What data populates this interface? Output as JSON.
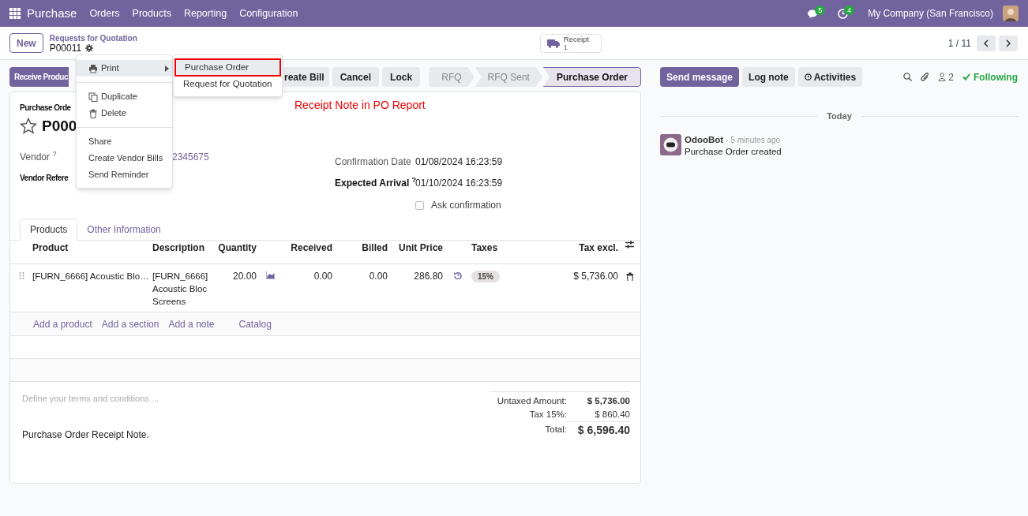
{
  "navbar": {
    "app_name": "Purchase",
    "menu": [
      "Orders",
      "Products",
      "Reporting",
      "Configuration"
    ],
    "messages_count": "5",
    "activities_count": "4",
    "company": "My Company (San Francisco)"
  },
  "control_panel": {
    "new_button": "New",
    "breadcrumb": "Requests for Quotation",
    "record": "P00011",
    "smart_button": {
      "label": "Receipt",
      "count": "1"
    },
    "pager": "1 / 11"
  },
  "actions": [
    {
      "label": "Receive Produc",
      "kind": "primary"
    },
    {
      "label": "reate Bill",
      "kind": "secondary"
    },
    {
      "label": "Cancel",
      "kind": "secondary"
    },
    {
      "label": "Lock",
      "kind": "secondary"
    }
  ],
  "statusbar": [
    {
      "label": "RFQ",
      "selected": false
    },
    {
      "label": "RFQ Sent",
      "selected": false
    },
    {
      "label": "Purchase Order",
      "selected": true
    }
  ],
  "gear_menu": {
    "groups": [
      [
        {
          "label": "Print",
          "kind": "submenu",
          "selected": true
        }
      ],
      [
        {
          "label": "Duplicate",
          "kind": "item",
          "selected": false
        },
        {
          "label": "Delete",
          "kind": "item",
          "selected": false
        }
      ],
      [
        {
          "label": "Share",
          "kind": "item",
          "selected": false
        },
        {
          "label": "Create Vendor Bills",
          "kind": "item",
          "selected": false
        },
        {
          "label": "Send Reminder",
          "kind": "item",
          "selected": false
        }
      ]
    ],
    "submenu": [
      {
        "label": "Purchase Order",
        "selected": true
      },
      {
        "label": "Request for Quotation",
        "selected": false
      }
    ]
  },
  "annotation": "Receipt Note in  PO Report",
  "form": {
    "title_label": "Purchase Orde",
    "name": "P000",
    "starred": false,
    "left_fields": [
      {
        "label": "Vendor $^{?}$",
        "value": "2345675",
        "bold_label": false
      },
      {
        "label": "Vendor Refere",
        "bold_label": true
      }
    ],
    "right_fields": [
      {
        "label": "Confirmation Date",
        "value": "01/08/2024 16:23:59",
        "bold_label": false
      },
      {
        "label": "Expected Arrival $^{?}$",
        "value": "01/10/2024 16:23:59",
        "bold_label": true
      }
    ],
    "ask_confirmation": {
      "label": "Ask confirmation",
      "checked": false
    },
    "tabs": [
      {
        "label": "Products",
        "selected": true
      },
      {
        "label": "Other Information",
        "selected": false
      }
    ],
    "table": {
      "columns": [
        "Product",
        "Description",
        "Quantity",
        "Received",
        "Billed",
        "Unit Price",
        "Taxes",
        "Tax excl."
      ],
      "rows": [
        {
          "product": "[FURN_6666] Acoustic Blo…",
          "description": [
            "[FURN_6666]",
            "Acoustic Bloc",
            "Screens"
          ],
          "quantity": "20.00",
          "received": "0.00",
          "billed": "0.00",
          "unit_price": "286.80",
          "taxes": "15%",
          "tax_excl": "$ 5,736.00"
        }
      ],
      "add_links": [
        "Add a product",
        "Add a section",
        "Add a note",
        "Catalog"
      ]
    },
    "terms_placeholder": "Define your terms and conditions ...",
    "note": "Purchase Order Receipt Note.",
    "totals": [
      {
        "label": "Untaxed Amount:",
        "value": "$ 5,736.00",
        "kind": "subtotal"
      },
      {
        "label": "Tax 15%:",
        "value": "$ 860.40",
        "kind": "tax"
      },
      {
        "label": "Total:",
        "value": "$ 6,596.40",
        "kind": "total"
      }
    ]
  },
  "chatter": {
    "buttons": [
      {
        "label": "Send message",
        "kind": "primary"
      },
      {
        "label": "Log note",
        "kind": "secondary"
      },
      {
        "label": "Activities",
        "kind": "secondary"
      }
    ],
    "followers_count": "2",
    "following": "Following",
    "date_divider": "Today",
    "messages": [
      {
        "author": "OdooBot",
        "time": "- 5 minutes ago",
        "body": "Purchase Order created"
      }
    ]
  }
}
